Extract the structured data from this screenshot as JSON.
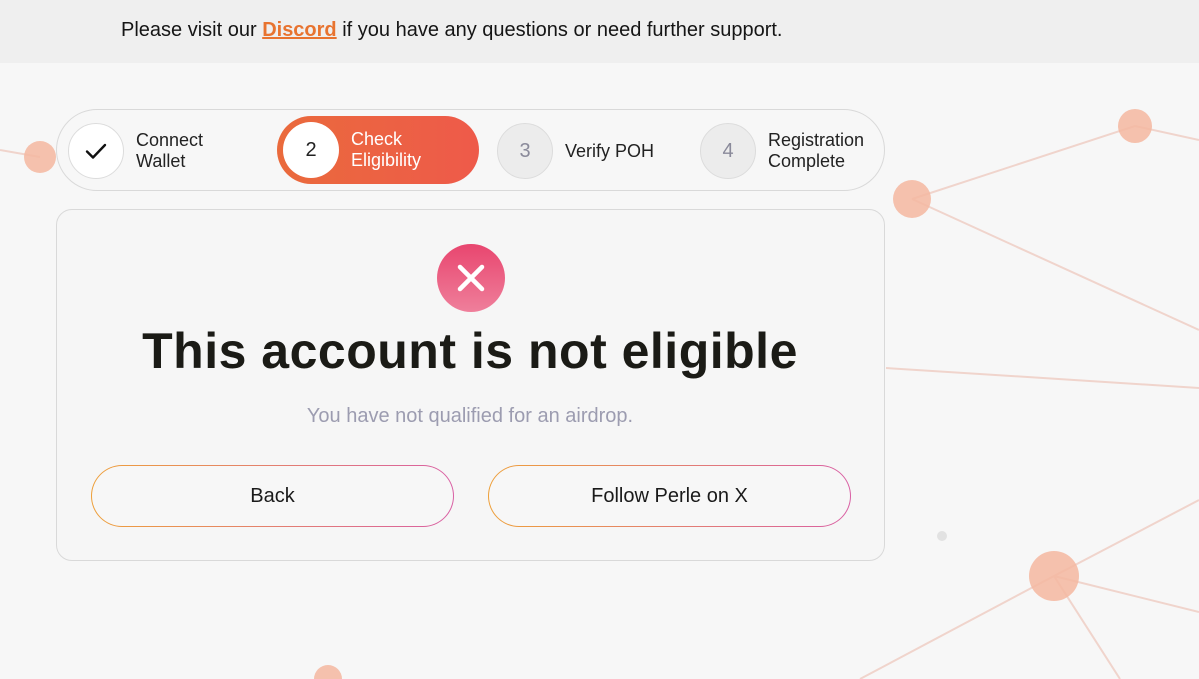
{
  "banner": {
    "prefix": "Please visit our",
    "link": "Discord",
    "suffix": "if you have any questions or need further support."
  },
  "steps": [
    {
      "marker": "✓",
      "label": "Connect Wallet",
      "state": "done"
    },
    {
      "marker": "2",
      "label": "Check Eligibility",
      "state": "active"
    },
    {
      "marker": "3",
      "label": "Verify POH",
      "state": "pending"
    },
    {
      "marker": "4",
      "label": "Registration Complete",
      "state": "pending"
    }
  ],
  "result": {
    "icon": "close-icon",
    "title": "This account is not eligible",
    "subtitle": "You have not qualified for an airdrop."
  },
  "actions": {
    "back_label": "Back",
    "follow_label": "Follow Perle on X"
  },
  "colors": {
    "accent": "#ea6a3c",
    "link": "#e8732f",
    "error": "#e8466f",
    "border_gradient_start": "#eea03a",
    "border_gradient_end": "#d95fa4"
  }
}
